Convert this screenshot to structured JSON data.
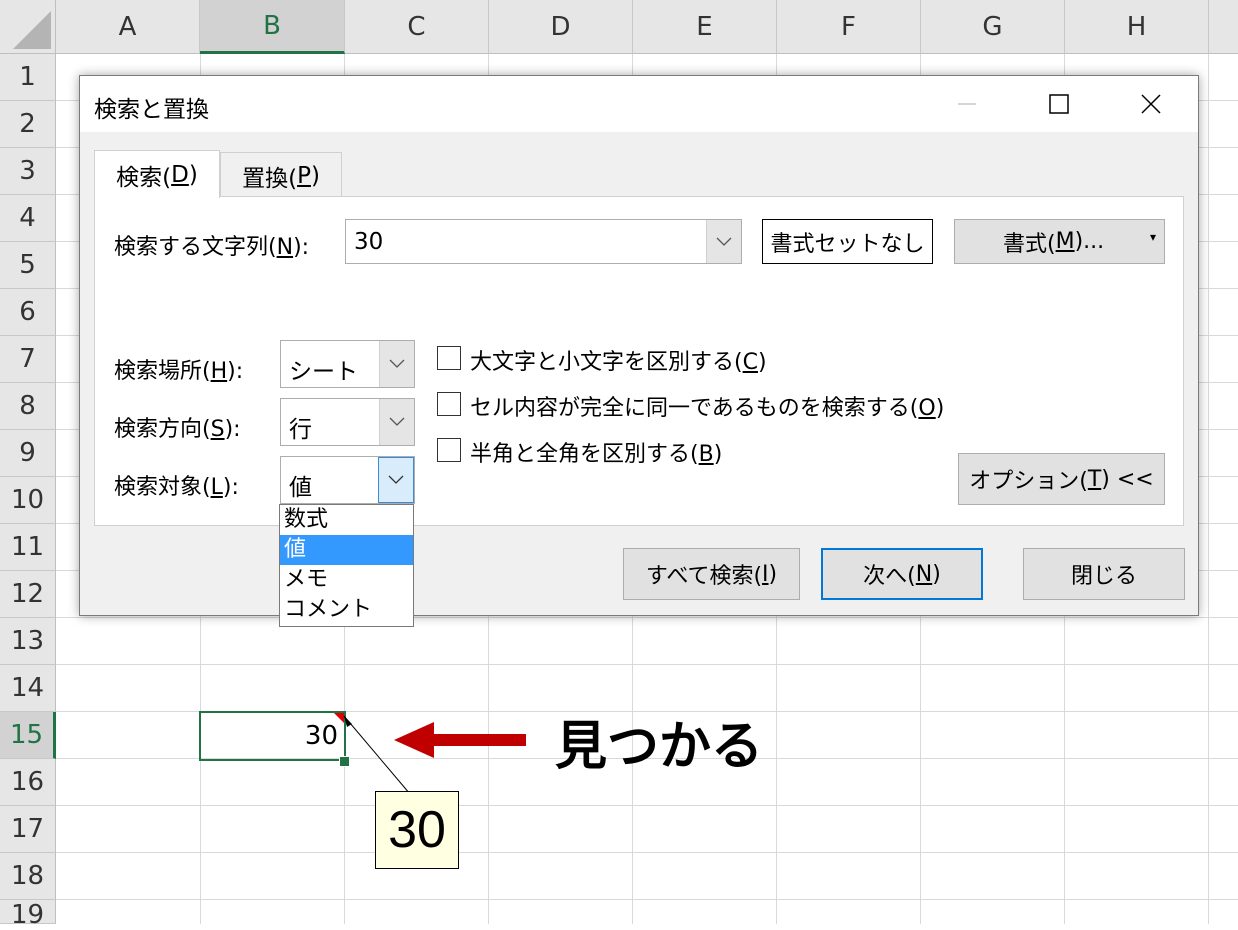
{
  "sheet": {
    "columns": [
      "A",
      "B",
      "C",
      "D",
      "E",
      "F",
      "G",
      "H"
    ],
    "rows": [
      "1",
      "2",
      "3",
      "4",
      "5",
      "6",
      "7",
      "8",
      "9",
      "10",
      "11",
      "12",
      "13",
      "14",
      "15",
      "16",
      "17",
      "18",
      "19"
    ],
    "active_cell_value": "30",
    "comment_text": "30",
    "callout_text": "見つかる",
    "accent_color": "#217346",
    "arrow_color": "#c00000"
  },
  "dialog": {
    "title": "検索と置換",
    "tabs": [
      {
        "label": "検索(",
        "key": "D",
        "tail": ")"
      },
      {
        "label": "置換(",
        "key": "P",
        "tail": ")"
      }
    ],
    "find_label": {
      "label": "検索する文字列(",
      "key": "N",
      "tail": "):"
    },
    "find_value": "30",
    "no_format_button": "書式セットなし",
    "format_button": {
      "label": "書式(",
      "key": "M",
      "tail": ")..."
    },
    "within_label": {
      "label": "検索場所(",
      "key": "H",
      "tail": "):"
    },
    "within_value": "シート",
    "search_label": {
      "label": "検索方向(",
      "key": "S",
      "tail": "):"
    },
    "search_value": "行",
    "lookin_label": {
      "label": "検索対象(",
      "key": "L",
      "tail": "):"
    },
    "lookin_value": "値",
    "lookin_options": [
      "数式",
      "値",
      "メモ",
      "コメント"
    ],
    "lookin_selected_index": 1,
    "checkboxes": [
      {
        "label": "大文字と小文字を区別する(",
        "key": "C",
        "tail": ")",
        "checked": false
      },
      {
        "label": "セル内容が完全に同一であるものを検索する(",
        "key": "O",
        "tail": ")",
        "checked": false
      },
      {
        "label": "半角と全角を区別する(",
        "key": "B",
        "tail": ")",
        "checked": false
      }
    ],
    "options_button": {
      "label": "オプション(",
      "key": "T",
      "tail": ") <<"
    },
    "find_all_button": {
      "label": "すべて検索(",
      "key": "I",
      "tail": ")"
    },
    "find_next_button": {
      "label": "次へ(",
      "key": "N",
      "tail": ")"
    },
    "close_button": "閉じる"
  }
}
